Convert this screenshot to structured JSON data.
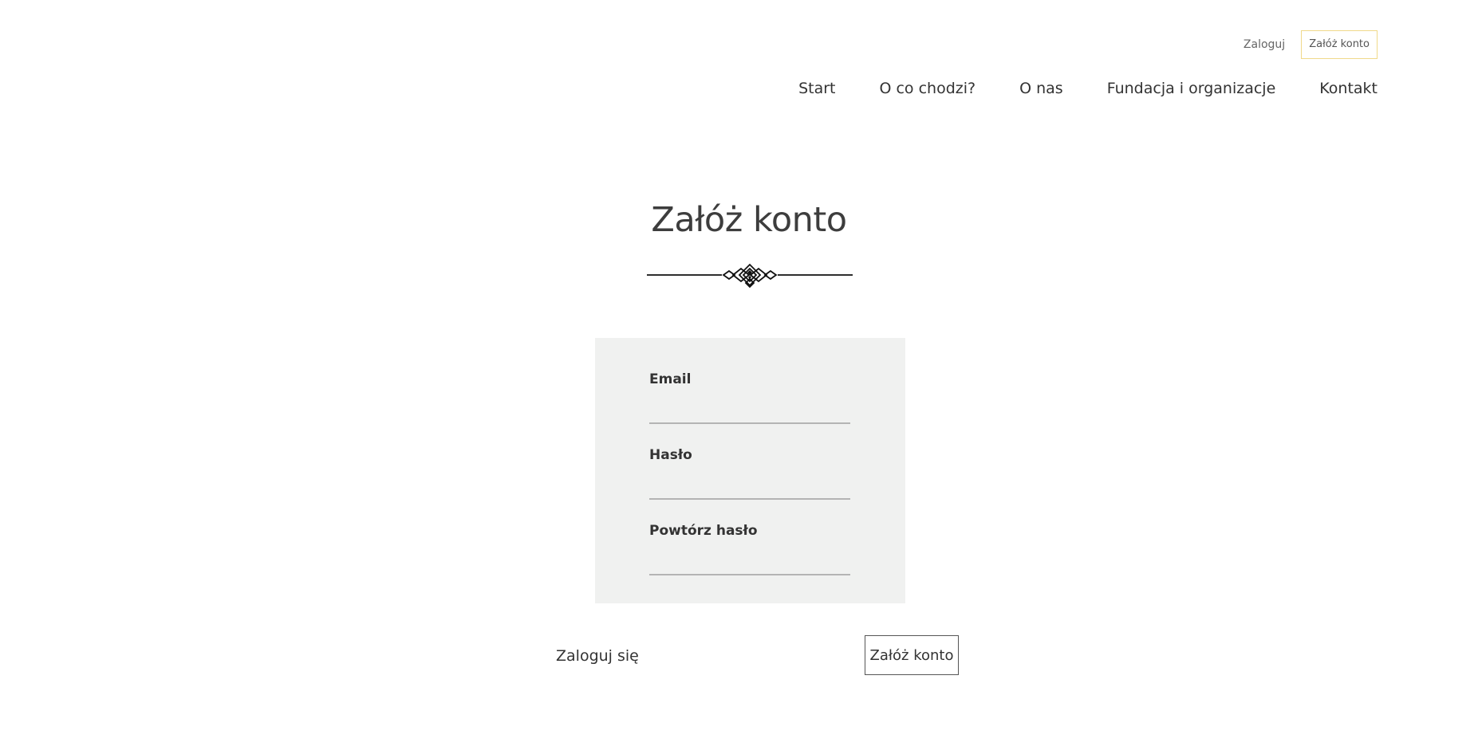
{
  "header": {
    "login_link": "Zaloguj",
    "register_button": "Załóż konto"
  },
  "nav": {
    "items": [
      "Start",
      "O co chodzi?",
      "O nas",
      "Fundacja i organizacje",
      "Kontakt"
    ]
  },
  "main": {
    "title": "Załóż konto",
    "ornament_icon": "ornamental-divider-icon",
    "form": {
      "email_label": "Email",
      "email_value": "",
      "password_label": "Hasło",
      "password_value": "",
      "repeat_password_label": "Powtórz hasło",
      "repeat_password_value": ""
    },
    "login_link": "Zaloguj się",
    "submit_button": "Załóż konto"
  },
  "colors": {
    "panel_background": "#f0f1f0",
    "header_button_border": "#f0d98a",
    "input_underline": "#b4b4b4"
  }
}
